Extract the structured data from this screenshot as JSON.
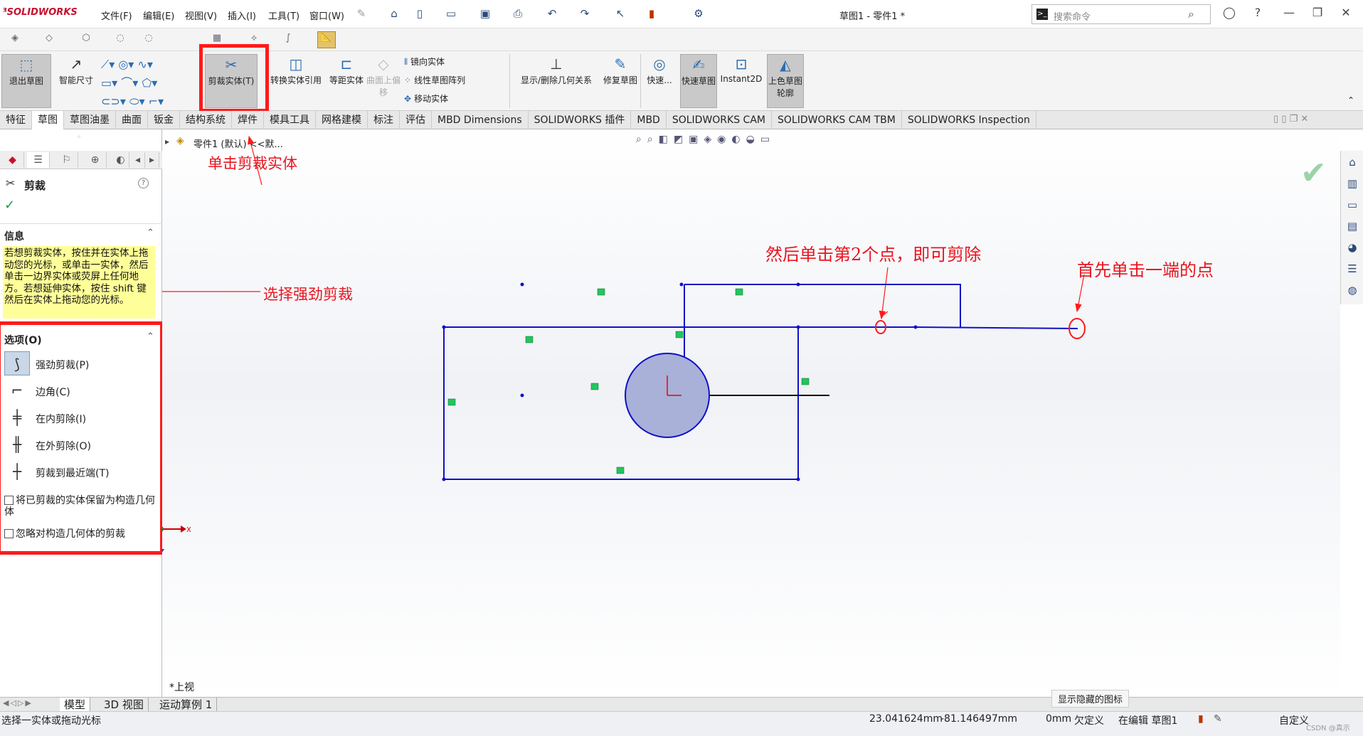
{
  "app": {
    "logo_text": "SOLIDWORKS",
    "doc_title": "草图1 - 零件1 *"
  },
  "menu": [
    "文件(F)",
    "编辑(E)",
    "视图(V)",
    "插入(I)",
    "工具(T)",
    "窗口(W)"
  ],
  "search": {
    "placeholder": "搜索命令"
  },
  "commands": {
    "exit_sketch": "退出草图",
    "smart_dim": "智能尺寸",
    "trim": "剪裁实体(T)",
    "convert": "转换实体引用",
    "offset": "等距实体",
    "surface_offset": "曲面上偏移",
    "mirror": "镜向实体",
    "linear_pattern": "线性草图阵列",
    "move": "移动实体",
    "display_relations": "显示/删除几何关系",
    "repair": "修复草图",
    "quick_snap": "快速...",
    "rapid_sketch": "快速草图",
    "instant2d": "Instant2D",
    "shaded": "上色草图轮廓"
  },
  "tabs": [
    "特征",
    "草图",
    "草图油墨",
    "曲面",
    "钣金",
    "结构系统",
    "焊件",
    "模具工具",
    "网格建模",
    "标注",
    "评估",
    "MBD Dimensions",
    "SOLIDWORKS 插件",
    "MBD",
    "SOLIDWORKS CAM",
    "SOLIDWORKS CAM TBM",
    "SOLIDWORKS Inspection"
  ],
  "tree": {
    "breadcrumb": "零件1 (默认) <<默..."
  },
  "panel": {
    "title": "剪裁",
    "info_header": "信息",
    "info_text": "若想剪裁实体，按住并在实体上拖动您的光标，或单击一实体，然后单击一边界实体或荧屏上任何地方。若想延伸实体，按住 shift 键然后在实体上拖动您的光标。",
    "options_header": "选项(O)",
    "options": [
      "强劲剪裁(P)",
      "边角(C)",
      "在内剪除(I)",
      "在外剪除(O)",
      "剪裁到最近端(T)"
    ],
    "check1": "将已剪裁的实体保留为构造几何体",
    "check2": "忽略对构造几何体的剪裁"
  },
  "annotations": {
    "click_trim": "单击剪裁实体",
    "select_power": "选择强劲剪裁",
    "then_click": "然后单击第2个点，即可剪除",
    "first_click": "首先单击一端的点"
  },
  "view_label": "*上视",
  "bottom_tabs": [
    "模型",
    "3D 视图",
    "运动算例 1"
  ],
  "tooltip": "显示隐藏的图标",
  "status": {
    "hint": "选择一实体或拖动光标",
    "x": "23.041624mm",
    "y": "-81.146497mm",
    "z": "0mm",
    "state": "欠定义",
    "editing": "在编辑 草图1",
    "units": "自定义",
    "watermark": "CSDN @真示"
  },
  "colors": {
    "accent_red": "#ff1a1a",
    "sketch_blue": "#1010c8",
    "relation_green": "#22c55e"
  }
}
